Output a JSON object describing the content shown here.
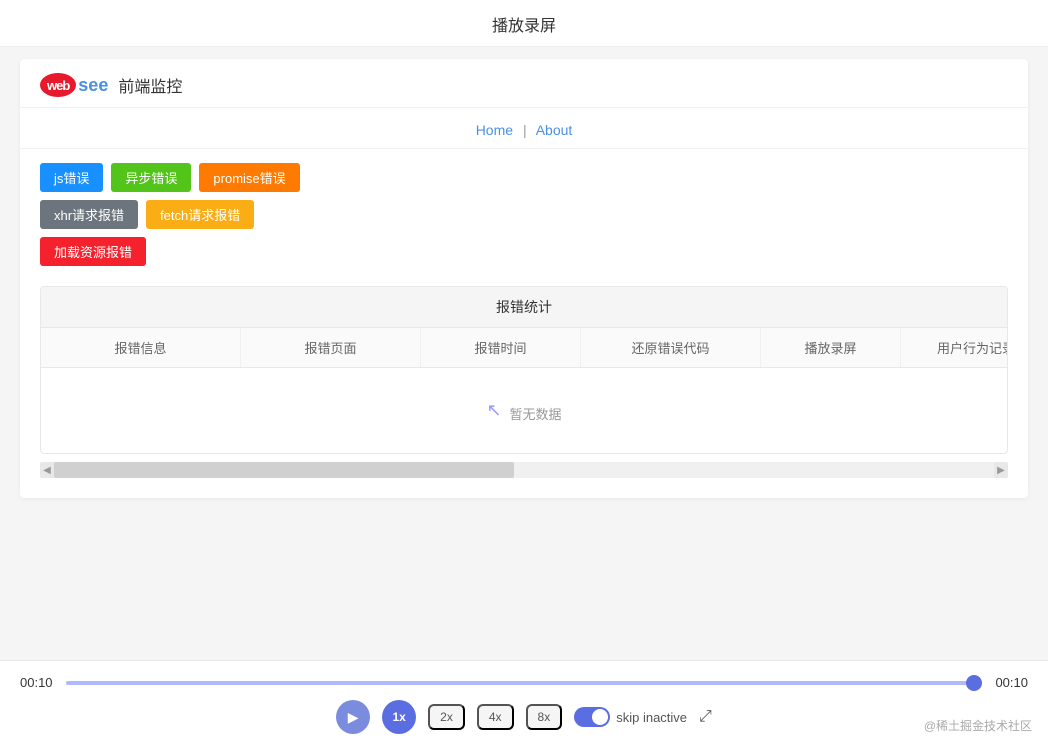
{
  "pageTitle": "播放录屏",
  "logo": {
    "badge": "web",
    "see": "see",
    "label": "前端监控"
  },
  "nav": {
    "homeLabel": "Home",
    "separator": "|",
    "aboutLabel": "About"
  },
  "buttons": [
    {
      "label": "js错误",
      "class": "btn-blue"
    },
    {
      "label": "异步错误",
      "class": "btn-green"
    },
    {
      "label": "promise错误",
      "class": "btn-orange"
    },
    {
      "label": "xhr请求报错",
      "class": "btn-gray"
    },
    {
      "label": "fetch请求报错",
      "class": "btn-amber"
    },
    {
      "label": "加载资源报错",
      "class": "btn-red"
    }
  ],
  "table": {
    "sectionTitle": "报错统计",
    "columns": [
      "报错信息",
      "报错页面",
      "报错时间",
      "还原错误代码",
      "播放录屏",
      "用户行为记录"
    ],
    "emptyText": "暂无数据"
  },
  "player": {
    "timeStart": "00:10",
    "timeEnd": "00:10",
    "controls": {
      "playIcon": "▶",
      "speedLabels": [
        "1x",
        "2x",
        "4x",
        "8x"
      ],
      "activeSpeed": "1x",
      "skipLabel": "skip inactive",
      "expandIcon": "⤢"
    }
  },
  "watermark": "@稀土掘金技术社区"
}
